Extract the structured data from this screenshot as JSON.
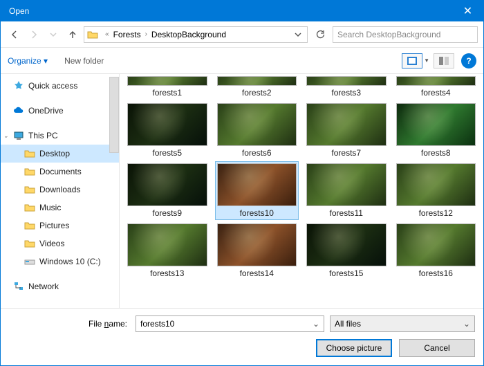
{
  "titlebar": {
    "title": "Open"
  },
  "nav": {
    "crumb1": "Forests",
    "crumb2": "DesktopBackground",
    "search_placeholder": "Search DesktopBackground"
  },
  "toolbar": {
    "organize": "Organize",
    "newfolder": "New folder"
  },
  "sidebar": {
    "quick": "Quick access",
    "onedrive": "OneDrive",
    "thispc": "This PC",
    "desktop": "Desktop",
    "documents": "Documents",
    "downloads": "Downloads",
    "music": "Music",
    "pictures": "Pictures",
    "videos": "Videos",
    "windrive": "Windows 10 (C:)",
    "network": "Network"
  },
  "items": {
    "i1": "forests1",
    "i2": "forests2",
    "i3": "forests3",
    "i4": "forests4",
    "i5": "forests5",
    "i6": "forests6",
    "i7": "forests7",
    "i8": "forests8",
    "i9": "forests9",
    "i10": "forests10",
    "i11": "forests11",
    "i12": "forests12",
    "i13": "forests13",
    "i14": "forests14",
    "i15": "forests15",
    "i16": "forests16"
  },
  "footer": {
    "filename_label_pre": "File ",
    "filename_label_u": "n",
    "filename_label_post": "ame:",
    "filename_value": "forests10",
    "filter": "All files",
    "choose": "Choose picture",
    "cancel": "Cancel"
  }
}
